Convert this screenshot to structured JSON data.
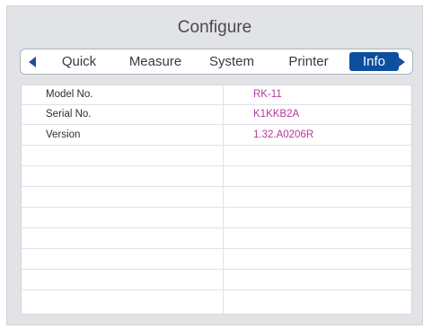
{
  "header": {
    "title": "Configure"
  },
  "tabs": [
    {
      "label": "Quick",
      "active": false
    },
    {
      "label": "Measure",
      "active": false
    },
    {
      "label": "System",
      "active": false
    },
    {
      "label": "Printer",
      "active": false
    },
    {
      "label": "Info",
      "active": true
    }
  ],
  "nav_icons": {
    "prev": "triangle-left-icon",
    "next": "triangle-right-icon"
  },
  "info_table": {
    "rows": [
      {
        "label": "Model No.",
        "value": "RK-11"
      },
      {
        "label": "Serial No.",
        "value": "K1KKB2A"
      },
      {
        "label": "Version",
        "value": "1.32.A0206R"
      },
      {
        "label": "",
        "value": ""
      },
      {
        "label": "",
        "value": ""
      },
      {
        "label": "",
        "value": ""
      },
      {
        "label": "",
        "value": ""
      },
      {
        "label": "",
        "value": ""
      },
      {
        "label": "",
        "value": ""
      },
      {
        "label": "",
        "value": ""
      },
      {
        "label": "",
        "value": ""
      }
    ]
  },
  "colors": {
    "accent": "#0c4f9e",
    "value_text": "#b23a9b",
    "panel_background": "#e1e3e7"
  }
}
